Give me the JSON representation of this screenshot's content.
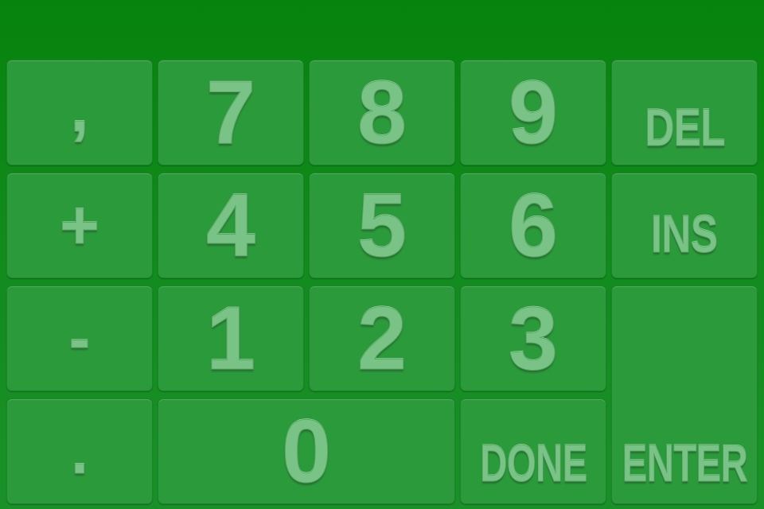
{
  "keypad": {
    "row1": {
      "comma": ",",
      "seven": "7",
      "eight": "8",
      "nine": "9",
      "del": "DEL"
    },
    "row2": {
      "plus": "+",
      "four": "4",
      "five": "5",
      "six": "6",
      "ins": "INS"
    },
    "row3": {
      "minus": "-",
      "one": "1",
      "two": "2",
      "three": "3"
    },
    "row4": {
      "dot": ".",
      "zero": "0",
      "done": "DONE"
    },
    "enter": "ENTER"
  },
  "colors": {
    "background": "#0a870f",
    "key": "#2b9a3b",
    "label": "#7ac387"
  }
}
